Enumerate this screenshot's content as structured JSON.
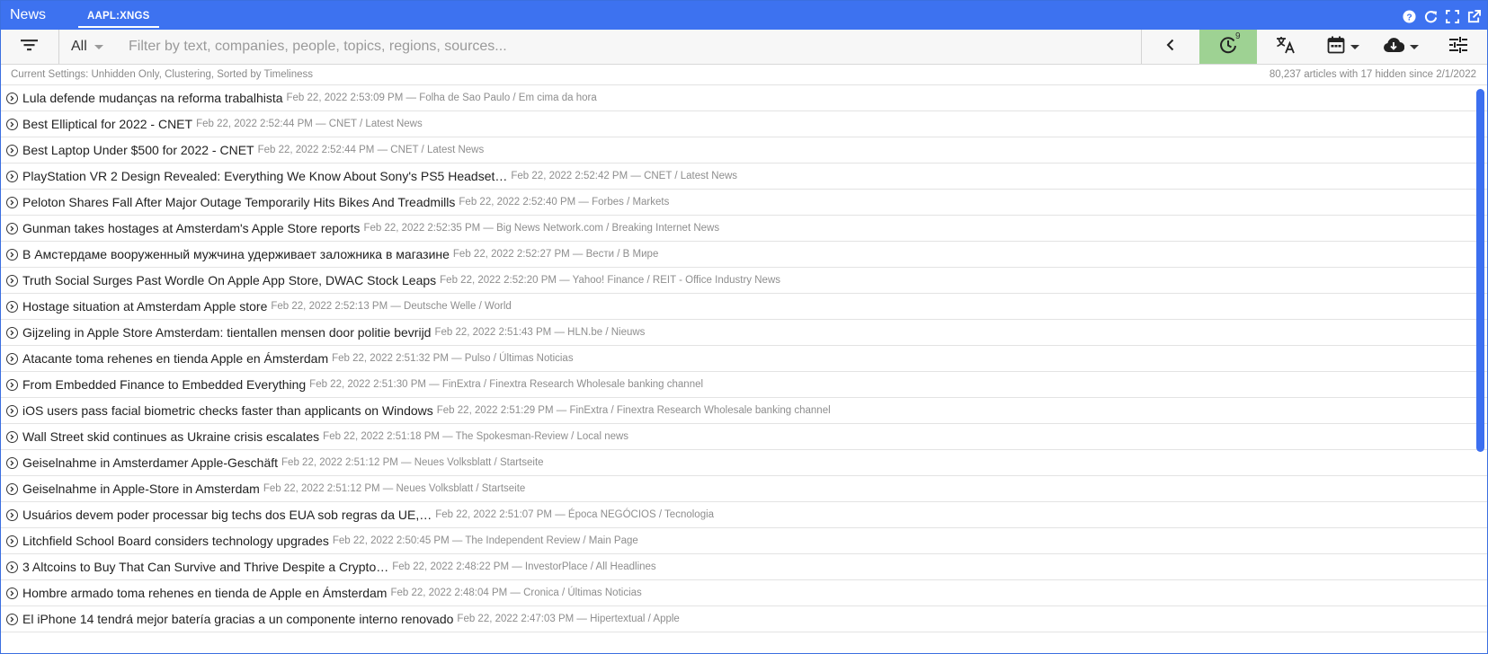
{
  "titlebar": {
    "app_title": "News",
    "ticker_tab": "AAPL:XNGS"
  },
  "toolbar": {
    "scope": "All",
    "search_placeholder": "Filter by text, companies, people, topics, regions, sources...",
    "clock_badge": "9"
  },
  "status": {
    "settings": "Current Settings: Unhidden Only, Clustering, Sorted by Timeliness",
    "count": "80,237 articles with 17 hidden since 2/1/2022"
  },
  "articles": [
    {
      "headline": "Lula defende mudanças na reforma trabalhista",
      "meta": "Feb 22, 2022 2:53:09 PM — Folha de Sao Paulo / Em cima da hora"
    },
    {
      "headline": "Best Elliptical for 2022 - CNET",
      "meta": "Feb 22, 2022 2:52:44 PM — CNET / Latest News"
    },
    {
      "headline": "Best Laptop Under $500 for 2022 - CNET",
      "meta": "Feb 22, 2022 2:52:44 PM — CNET / Latest News"
    },
    {
      "headline": "PlayStation VR 2 Design Revealed: Everything We Know About Sony's PS5 Headset…",
      "meta": "Feb 22, 2022 2:52:42 PM — CNET / Latest News"
    },
    {
      "headline": "Peloton Shares Fall After Major Outage Temporarily Hits Bikes And Treadmills",
      "meta": "Feb 22, 2022 2:52:40 PM — Forbes / Markets"
    },
    {
      "headline": "Gunman takes hostages at Amsterdam's Apple Store reports",
      "meta": "Feb 22, 2022 2:52:35 PM — Big News Network.com / Breaking Internet News"
    },
    {
      "headline": "В Амстердаме вооруженный мужчина удерживает заложника в магазине",
      "meta": "Feb 22, 2022 2:52:27 PM — Вести / В Мире"
    },
    {
      "headline": "Truth Social Surges Past Wordle On Apple App Store, DWAC Stock Leaps",
      "meta": "Feb 22, 2022 2:52:20 PM — Yahoo! Finance / REIT - Office Industry News"
    },
    {
      "headline": "Hostage situation at Amsterdam Apple store",
      "meta": "Feb 22, 2022 2:52:13 PM — Deutsche Welle / World"
    },
    {
      "headline": "Gijzeling in Apple Store Amsterdam: tientallen mensen door politie bevrijd",
      "meta": "Feb 22, 2022 2:51:43 PM — HLN.be / Nieuws"
    },
    {
      "headline": "Atacante toma rehenes en tienda Apple en Ámsterdam",
      "meta": "Feb 22, 2022 2:51:32 PM — Pulso / Últimas Noticias"
    },
    {
      "headline": "From Embedded Finance to Embedded Everything",
      "meta": "Feb 22, 2022 2:51:30 PM — FinExtra / Finextra Research Wholesale banking channel"
    },
    {
      "headline": "iOS users pass facial biometric checks faster than applicants on Windows",
      "meta": "Feb 22, 2022 2:51:29 PM — FinExtra / Finextra Research Wholesale banking channel"
    },
    {
      "headline": "Wall Street skid continues as Ukraine crisis escalates",
      "meta": "Feb 22, 2022 2:51:18 PM — The Spokesman-Review / Local news"
    },
    {
      "headline": "Geiselnahme in Amsterdamer Apple-Geschäft",
      "meta": "Feb 22, 2022 2:51:12 PM — Neues Volksblatt / Startseite"
    },
    {
      "headline": "Geiselnahme in Apple-Store in Amsterdam",
      "meta": "Feb 22, 2022 2:51:12 PM — Neues Volksblatt / Startseite"
    },
    {
      "headline": "Usuários devem poder processar big techs dos EUA sob regras da UE,…",
      "meta": "Feb 22, 2022 2:51:07 PM — Época NEGÓCIOS / Tecnologia"
    },
    {
      "headline": "Litchfield School Board considers technology upgrades",
      "meta": "Feb 22, 2022 2:50:45 PM — The Independent Review / Main Page"
    },
    {
      "headline": "3 Altcoins to Buy That Can Survive and Thrive Despite a Crypto…",
      "meta": "Feb 22, 2022 2:48:22 PM — InvestorPlace / All Headlines"
    },
    {
      "headline": "Hombre armado toma rehenes en tienda de Apple en Ámsterdam",
      "meta": "Feb 22, 2022 2:48:04 PM — Cronica / Últimas Noticias"
    },
    {
      "headline": "El iPhone 14 tendrá mejor batería gracias a un componente interno renovado",
      "meta": "Feb 22, 2022 2:47:03 PM — Hipertextual / Apple"
    }
  ]
}
